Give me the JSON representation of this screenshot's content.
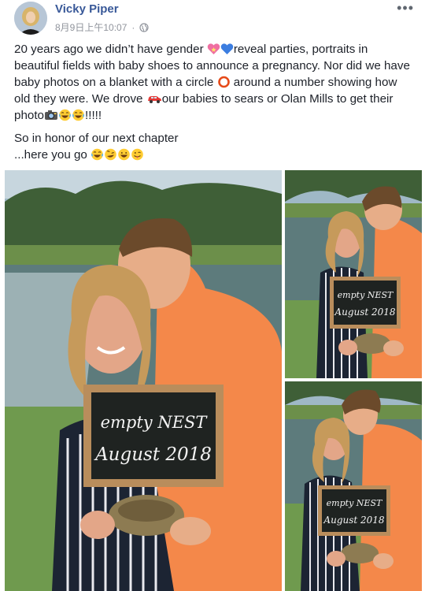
{
  "post": {
    "author": "Vicky Piper",
    "timestamp": "8月9日上午10:07",
    "privacy_icon": "globe-icon",
    "menu_icon": "more-options-icon",
    "text": {
      "p1": {
        "a": "20 years ago we didn’t have gender ",
        "b": "reveal parties, portraits in beautiful fields with baby shoes to announce a pregnancy. Nor did we have baby photos on a blanket with a circle ",
        "c": " around a number showing how old they were. We drove ",
        "d": "our babies to sears or Olan Mills to get their photo",
        "e": "!!!!!"
      },
      "p2": "So in honor of our next chapter",
      "p3": "...here you go"
    },
    "emojis": [
      "heart-icon",
      "blue-heart-icon",
      "circle-icon",
      "car-icon",
      "camera-icon",
      "laughing-face-icon",
      "rofl-face-icon",
      "tongue-face-icon"
    ]
  },
  "photos": [
    {
      "sign_line1": "empty NEST",
      "sign_line2": "August 2018"
    },
    {
      "sign_line1": "empty NEST",
      "sign_line2": "August 2018"
    },
    {
      "sign_line1": "empty NEST",
      "sign_line2": "August 2018"
    }
  ],
  "colors": {
    "link_blue": "#385898",
    "shirt_orange": "#f4884a",
    "grass": "#6f9a4e",
    "chalkboard": "#1f2321",
    "frame_wood": "#b98d5c"
  }
}
